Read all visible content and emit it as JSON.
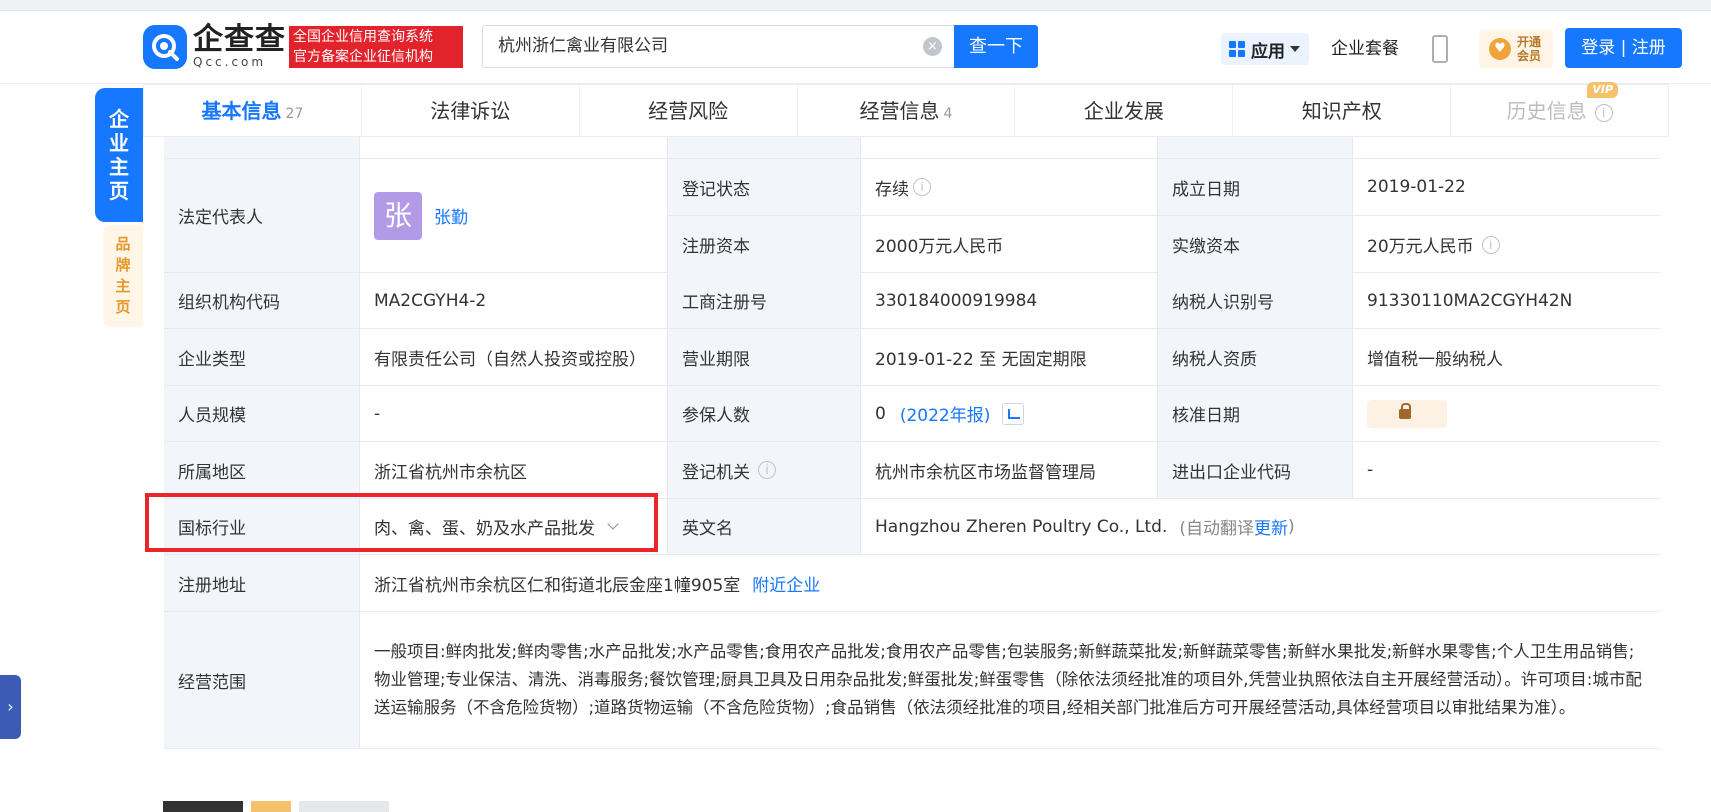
{
  "header": {
    "logo_cn": "企查查",
    "logo_en": "Qcc.com",
    "slogan_line1": "全国企业信用查询系统",
    "slogan_line2": "官方备案企业征信机构",
    "search_value": "杭州浙仁禽业有限公司",
    "search_button": "查一下",
    "app_label": "应用",
    "package_label": "企业套餐",
    "vip_line1": "开通",
    "vip_line2": "会员",
    "login_label": "登录 | 注册"
  },
  "leftnav": {
    "main": [
      "企",
      "业",
      "主",
      "页"
    ],
    "brand": [
      "品",
      "牌",
      "主",
      "页"
    ],
    "toggle": "›"
  },
  "tabs": [
    {
      "label": "基本信息",
      "count": "27"
    },
    {
      "label": "法律诉讼",
      "count": ""
    },
    {
      "label": "经营风险",
      "count": ""
    },
    {
      "label": "经营信息",
      "count": "4"
    },
    {
      "label": "企业发展",
      "count": ""
    },
    {
      "label": "知识产权",
      "count": ""
    },
    {
      "label": "历史信息",
      "count": "",
      "tag": "VIP"
    }
  ],
  "table": {
    "legal_rep_label": "法定代表人",
    "legal_rep_avatar": "张",
    "legal_rep_name": "张勤",
    "reg_status_label": "登记状态",
    "reg_status_value": "存续",
    "est_date_label": "成立日期",
    "est_date_value": "2019-01-22",
    "reg_capital_label": "注册资本",
    "reg_capital_value": "2000万元人民币",
    "paid_capital_label": "实缴资本",
    "paid_capital_value": "20万元人民币",
    "org_code_label": "组织机构代码",
    "org_code_value": "MA2CGYH4-2",
    "biz_reg_no_label": "工商注册号",
    "biz_reg_no_value": "330184000919984",
    "taxpayer_id_label": "纳税人识别号",
    "taxpayer_id_value": "91330110MA2CGYH42N",
    "company_type_label": "企业类型",
    "company_type_value": "有限责任公司（自然人投资或控股）",
    "biz_term_label": "营业期限",
    "biz_term_value": "2019-01-22 至 无固定期限",
    "taxpayer_qual_label": "纳税人资质",
    "taxpayer_qual_value": "增值税一般纳税人",
    "staff_size_label": "人员规模",
    "staff_size_value": "-",
    "insured_label": "参保人数",
    "insured_value": "0",
    "insured_year": "(2022年报)",
    "approval_date_label": "核准日期",
    "region_label": "所属地区",
    "region_value": "浙江省杭州市余杭区",
    "reg_authority_label": "登记机关",
    "reg_authority_value": "杭州市余杭区市场监督管理局",
    "import_export_label": "进出口企业代码",
    "import_export_value": "-",
    "industry_label": "国标行业",
    "industry_value": "肉、禽、蛋、奶及水产品批发",
    "english_name_label": "英文名",
    "english_name_value": "Hangzhou Zheren Poultry Co., Ltd.",
    "auto_translate_prefix": "(自动翻译",
    "auto_translate_link": "更新",
    "auto_translate_suffix": ")",
    "address_label": "注册地址",
    "address_value": "浙江省杭州市余杭区仁和街道北辰金座1幢905室",
    "nearby_link": "附近企业",
    "scope_label": "经营范围",
    "scope_value": "一般项目:鲜肉批发;鲜肉零售;水产品批发;水产品零售;食用农产品批发;食用农产品零售;包装服务;新鲜蔬菜批发;新鲜蔬菜零售;新鲜水果批发;新鲜水果零售;个人卫生用品销售;物业管理;专业保洁、清洗、消毒服务;餐饮管理;厨具卫具及日用杂品批发;鲜蛋批发;鲜蛋零售（除依法须经批准的项目外,凭营业执照依法自主开展经营活动）。许可项目:城市配送运输服务（不含危险货物）;道路货物运输（不含危险货物）;食品销售（依法须经批准的项目,经相关部门批准后方可开展经营活动,具体经营项目以审批结果为准）。"
  },
  "colors": {
    "accent": "#1677ff",
    "highlight_box": "#e8262b",
    "label_bg": "#f2f6fb"
  }
}
